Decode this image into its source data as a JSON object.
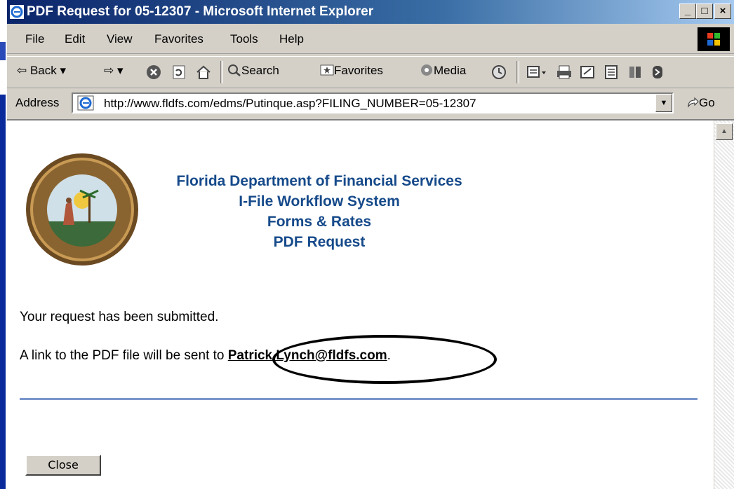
{
  "window": {
    "title": "PDF Request for 05-12307 - Microsoft Internet Explorer",
    "buttons": [
      "_",
      "□",
      "×"
    ]
  },
  "menu": [
    "File",
    "Edit",
    "View",
    "Favorites",
    "Tools",
    "Help"
  ],
  "toolbar": {
    "back": "Back",
    "search": "Search",
    "favorites": "Favorites",
    "media": "Media"
  },
  "address": {
    "label": "Address",
    "url": "http://www.fldfs.com/edms/Putinque.asp?FILING_NUMBER=05-12307",
    "go": "Go"
  },
  "page": {
    "header": [
      "Florida Department of Financial Services",
      "I-File Workflow System",
      "Forms & Rates",
      "PDF Request"
    ],
    "submitted": "Your request has been submitted.",
    "link_prefix": "A link to the PDF file will be sent to ",
    "email": "Patrick.Lynch@fldfs.com",
    "link_suffix": ".",
    "close_label": "Close"
  },
  "colors": {
    "titlebar_start": "#0a246a",
    "header_text": "#164a8a",
    "divider": "#7a96cc",
    "background": "#0a2a9c"
  }
}
